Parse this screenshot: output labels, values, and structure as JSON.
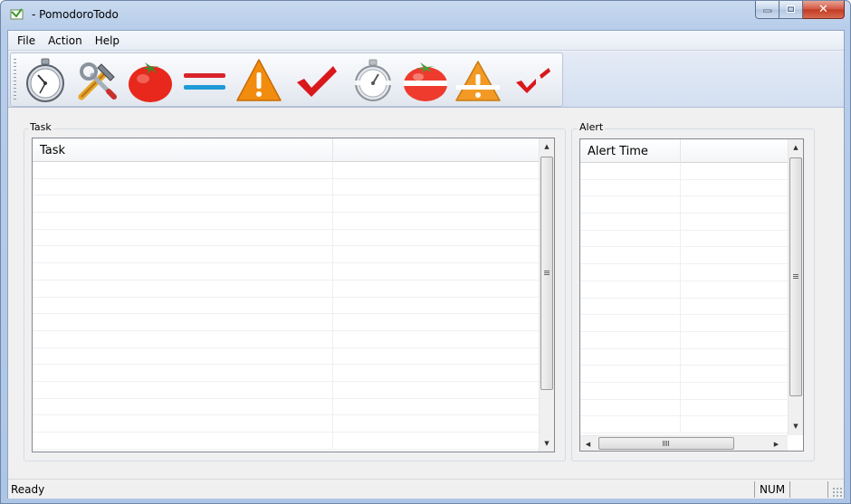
{
  "window": {
    "title": "- PomodoroTodo"
  },
  "menu": {
    "items": [
      "File",
      "Action",
      "Help"
    ]
  },
  "toolbar": {
    "buttons": [
      {
        "icon": "stopwatch-icon"
      },
      {
        "icon": "tools-icon"
      },
      {
        "icon": "tomato-icon"
      },
      {
        "icon": "interruption-lines-icon"
      },
      {
        "icon": "warning-icon"
      },
      {
        "icon": "checkmark-icon"
      },
      {
        "icon": "stopwatch-faded-icon"
      },
      {
        "icon": "tomato-faded-icon"
      },
      {
        "icon": "warning-faded-icon"
      },
      {
        "icon": "checkmark-small-icon"
      }
    ]
  },
  "task_panel": {
    "group_label": "Task",
    "columns": [
      "Task",
      ""
    ]
  },
  "alert_panel": {
    "group_label": "Alert",
    "columns": [
      "Alert Time",
      ""
    ]
  },
  "status": {
    "text": "Ready",
    "num": "NUM"
  },
  "colors": {
    "tomato": "#e8281c",
    "warning": "#f28c0f",
    "check": "#d9181c",
    "line_red": "#d8232a",
    "line_blue": "#1f9ad6"
  }
}
